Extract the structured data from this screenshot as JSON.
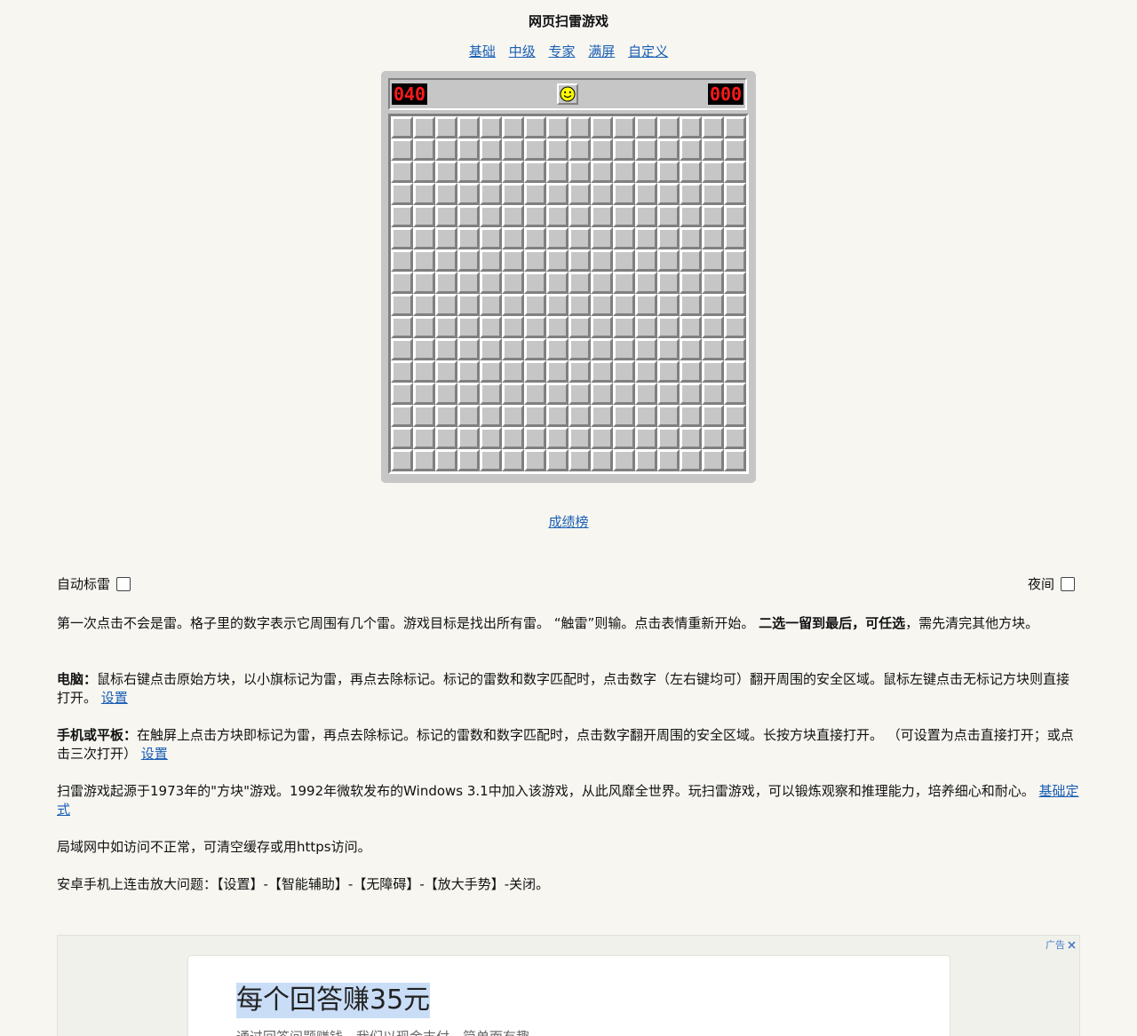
{
  "page": {
    "title": "网页扫雷游戏"
  },
  "modes": [
    "基础",
    "中级",
    "专家",
    "满屏",
    "自定义"
  ],
  "game": {
    "mines_left": "040",
    "timer": "000",
    "face": "smiley-face-icon",
    "rows": 16,
    "cols": 16
  },
  "scoreboard_label": "成绩榜",
  "options": {
    "auto_flag_label": "自动标雷",
    "night_label": "夜间"
  },
  "description": {
    "p1_a": "第一次点击不会是雷。格子里的数字表示它周围有几个雷。游戏目标是找出所有雷。 “触雷”则输。点击表情重新开始。 ",
    "p1_bold": "二选一留到最后，可任选",
    "p1_b": "，需先清完其他方块。",
    "p2_bold": "电脑：",
    "p2_text": "鼠标右键点击原始方块，以小旗标记为雷，再点去除标记。标记的雷数和数字匹配时，点击数字（左右键均可）翻开周围的安全区域。鼠标左键点击无标记方块则直接打开。 ",
    "p2_link": "设置",
    "p3_bold": "手机或平板：",
    "p3_text": "在触屏上点击方块即标记为雷，再点去除标记。标记的雷数和数字匹配时，点击数字翻开周围的安全区域。长按方块直接打开。 （可设置为点击直接打开；或点击三次打开） ",
    "p3_link": "设置",
    "p4_text": "扫雷游戏起源于1973年的\"方块\"游戏。1992年微软发布的Windows 3.1中加入该游戏，从此风靡全世界。玩扫雷游戏，可以锻炼观察和推理能力，培养细心和耐心。 ",
    "p4_link": "基础定式",
    "p5_text": "局域网中如访问不正常，可清空缓存或用https访问。",
    "p6_text": "安卓手机上连击放大问题：【设置】-【智能辅助】-【无障碍】-【放大手势】-关闭。"
  },
  "ad": {
    "tag": "广告",
    "headline": "每个回答赚35元",
    "subtext": "通过回答问题赚钱，我们以现金支付，简单而有趣"
  },
  "colors": {
    "link": "#1a5fb4",
    "board_bg": "#c6c6c6",
    "lcd_digit": "#ff1a1a",
    "page_bg": "#f7f6f1"
  }
}
